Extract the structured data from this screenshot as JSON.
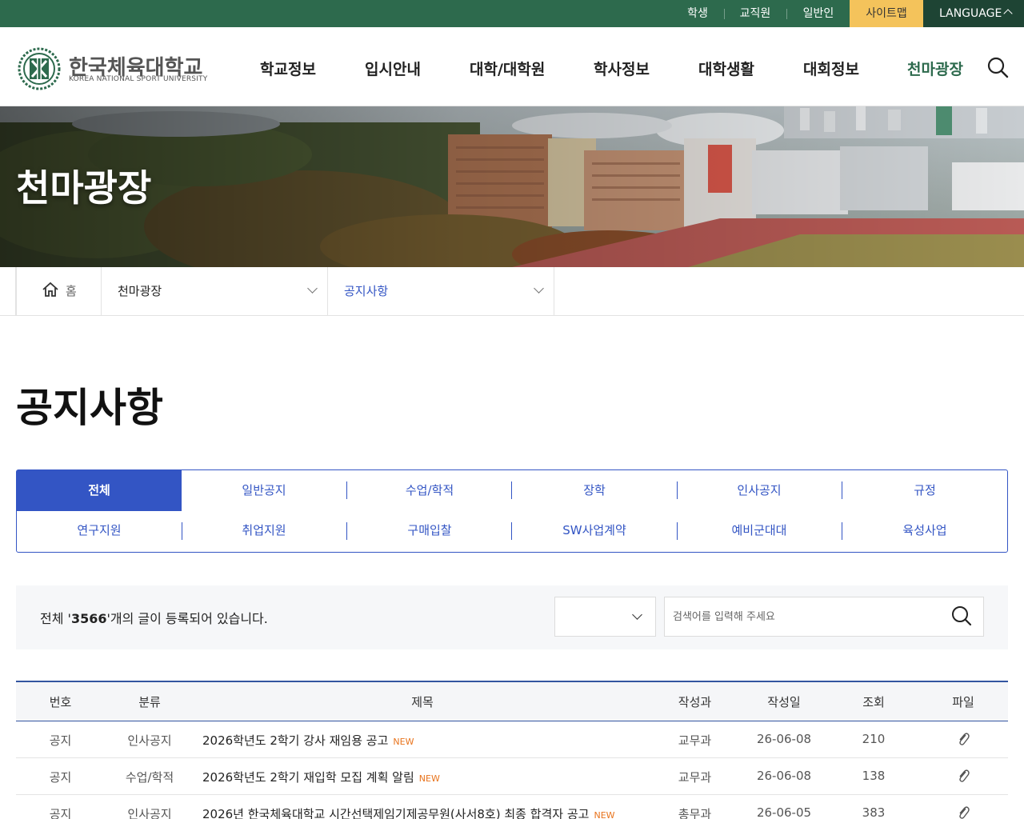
{
  "topbar": {
    "links": [
      "학생",
      "교직원",
      "일반인"
    ],
    "sitemap": "사이트맵",
    "language": "LANGUAGE"
  },
  "header": {
    "logo_ko": "한국체육대학교",
    "logo_en": "KOREA NATIONAL SPORT UNIVERSITY",
    "nav": [
      "학교정보",
      "입시안내",
      "대학/대학원",
      "학사정보",
      "대학생활",
      "대회정보",
      "천마광장"
    ]
  },
  "hero": {
    "title": "천마광장"
  },
  "breadcrumb": {
    "home": "홈",
    "level1": "천마광장",
    "level2": "공지사항"
  },
  "page_title": "공지사항",
  "tabs": [
    "전체",
    "일반공지",
    "수업/학적",
    "장학",
    "인사공지",
    "규정",
    "연구지원",
    "취업지원",
    "구매입찰",
    "SW사업계약",
    "예비군대대",
    "육성사업"
  ],
  "search": {
    "count_prefix": "전체 '",
    "count_value": "3566",
    "count_suffix": "'개의 글이 등록되어 있습니다.",
    "placeholder": "검색어를 입력해 주세요"
  },
  "table": {
    "headers": [
      "번호",
      "분류",
      "제목",
      "작성과",
      "작성일",
      "조회",
      "파일"
    ],
    "new_label": "NEW",
    "rows": [
      {
        "no": "공지",
        "category": "인사공지",
        "title": "2026학년도 2학기 강사 재임용 공고",
        "dept": "교무과",
        "date": "26-06-08",
        "views": "210"
      },
      {
        "no": "공지",
        "category": "수업/학적",
        "title": "2026학년도 2학기 재입학 모집 계획 알림",
        "dept": "교무과",
        "date": "26-06-08",
        "views": "138"
      },
      {
        "no": "공지",
        "category": "인사공지",
        "title": "2026년 한국체육대학교 시간선택제임기제공무원(사서8호) 최종 합격자 공고",
        "dept": "총무과",
        "date": "26-06-05",
        "views": "383"
      }
    ]
  },
  "colors": {
    "green": "#2d6a4d",
    "blue": "#3355c4",
    "yellow": "#f4c35b",
    "new": "#e8731c"
  }
}
